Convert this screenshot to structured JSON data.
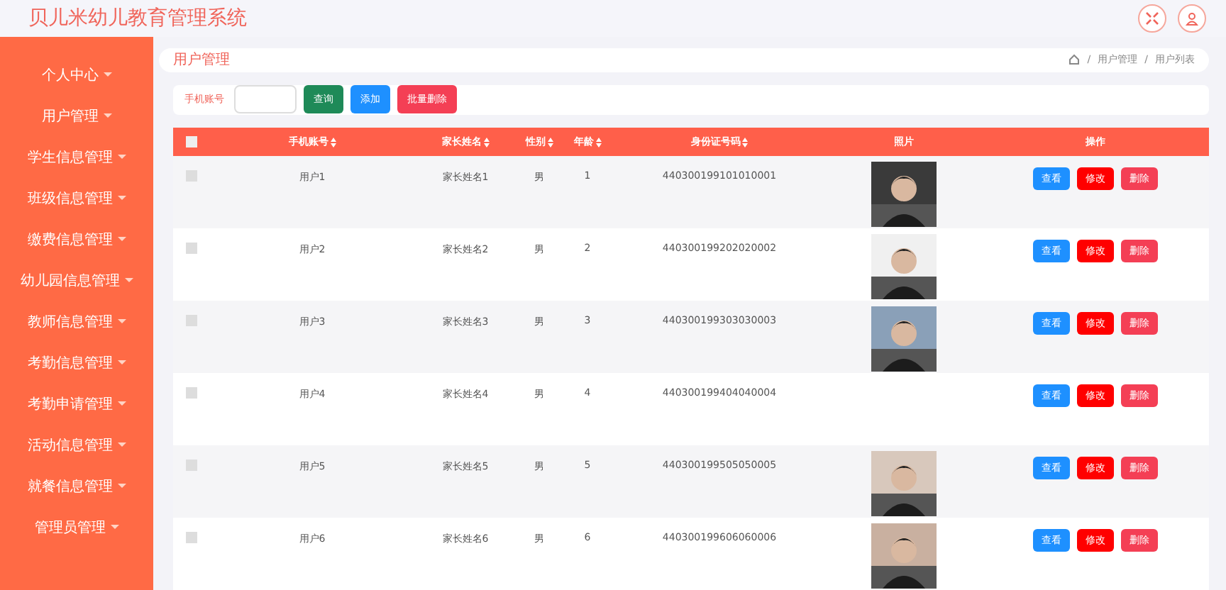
{
  "app_title": "贝儿米幼儿教育管理系统",
  "sidebar": {
    "items": [
      {
        "label": "个人中心",
        "selected": false
      },
      {
        "label": "用户管理",
        "selected": false
      },
      {
        "label": "学生信息管理",
        "selected": false
      },
      {
        "label": "班级信息管理",
        "selected": false
      },
      {
        "label": "缴费信息管理",
        "selected": false
      },
      {
        "label": "幼儿园信息管理",
        "selected": false
      },
      {
        "label": "教师信息管理",
        "selected": false
      },
      {
        "label": "考勤信息管理",
        "selected": false
      },
      {
        "label": "考勤申请管理",
        "selected": false
      },
      {
        "label": "活动信息管理",
        "selected": false
      },
      {
        "label": "就餐信息管理",
        "selected": false
      },
      {
        "label": "管理员管理",
        "selected": false
      }
    ]
  },
  "page_title": "用户管理",
  "breadcrumb": [
    {
      "separator": "/",
      "label": "用户管理"
    },
    {
      "separator": "/",
      "label": "用户列表"
    }
  ],
  "search": {
    "label": "手机账号",
    "buttons": [
      {
        "label": "查询",
        "kind": "search"
      },
      {
        "label": "添加",
        "kind": "add"
      },
      {
        "label": "批量删除",
        "kind": "delete"
      }
    ]
  },
  "table": {
    "all_checked": false,
    "columns": [
      {
        "label": "手机账号",
        "sortable": true
      },
      {
        "label": "家长姓名",
        "sortable": true
      },
      {
        "label": "性别",
        "sortable": true
      },
      {
        "label": "年龄",
        "sortable": true
      },
      {
        "label": "身份证号码",
        "sortable": true
      },
      {
        "label": "照片",
        "sortable": false
      },
      {
        "label": "操作",
        "sortable": false
      }
    ],
    "rows": [
      {
        "checked": false,
        "cells": [
          "用户1",
          "家长姓名1",
          "男",
          "1",
          "440300199101010001"
        ],
        "photo": {
          "kind": "picture"
        },
        "actions": [
          {
            "label": "查看",
            "kind": "view"
          },
          {
            "label": "修改",
            "kind": "edit"
          },
          {
            "label": "删除",
            "kind": "delete"
          }
        ]
      },
      {
        "checked": false,
        "cells": [
          "用户2",
          "家长姓名2",
          "男",
          "2",
          "440300199202020002"
        ],
        "photo": {
          "kind": "picture"
        },
        "actions": [
          {
            "label": "查看",
            "kind": "view"
          },
          {
            "label": "修改",
            "kind": "edit"
          },
          {
            "label": "删除",
            "kind": "delete"
          }
        ]
      },
      {
        "checked": false,
        "cells": [
          "用户3",
          "家长姓名3",
          "男",
          "3",
          "440300199303030003"
        ],
        "photo": {
          "kind": "picture"
        },
        "actions": [
          {
            "label": "查看",
            "kind": "view"
          },
          {
            "label": "修改",
            "kind": "edit"
          },
          {
            "label": "删除",
            "kind": "delete"
          }
        ]
      },
      {
        "checked": false,
        "cells": [
          "用户4",
          "家长姓名4",
          "男",
          "4",
          "440300199404040004"
        ],
        "actions": [
          {
            "label": "查看",
            "kind": "view"
          },
          {
            "label": "修改",
            "kind": "edit"
          },
          {
            "label": "删除",
            "kind": "delete"
          }
        ]
      },
      {
        "checked": false,
        "cells": [
          "用户5",
          "家长姓名5",
          "男",
          "5",
          "440300199505050005"
        ],
        "photo": {
          "kind": "picture"
        },
        "actions": [
          {
            "label": "查看",
            "kind": "view"
          },
          {
            "label": "修改",
            "kind": "edit"
          },
          {
            "label": "删除",
            "kind": "delete"
          }
        ]
      },
      {
        "checked": false,
        "cells": [
          "用户6",
          "家长姓名6",
          "男",
          "6",
          "440300199606060006"
        ],
        "photo": {
          "kind": "picture"
        },
        "actions": [
          {
            "label": "查看",
            "kind": "view"
          },
          {
            "label": "修改",
            "kind": "edit"
          },
          {
            "label": "删除",
            "kind": "delete"
          }
        ]
      }
    ]
  }
}
